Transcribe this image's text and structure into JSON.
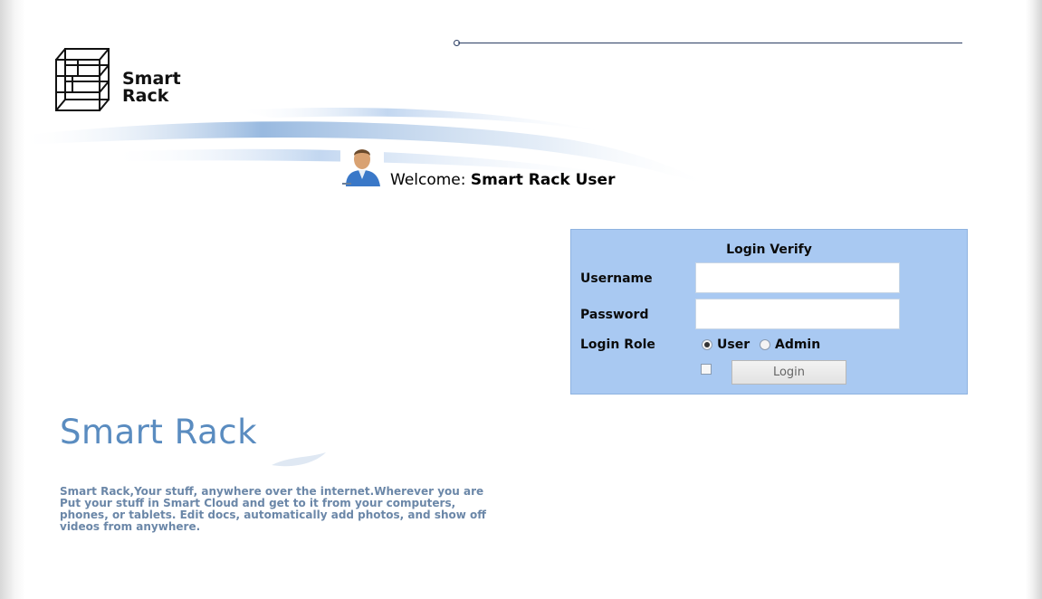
{
  "logo": {
    "line1": "Smart",
    "line2": "Rack",
    "icon": "rack-icon"
  },
  "welcome": {
    "prefix": "Welcome:",
    "user": "Smart Rack User",
    "icon": "user-avatar-icon"
  },
  "login": {
    "title": "Login Verify",
    "username_label": "Username",
    "username_value": "",
    "password_label": "Password",
    "password_value": "",
    "role_label": "Login Role",
    "roles": [
      {
        "label": "User",
        "selected": true
      },
      {
        "label": "Admin",
        "selected": false
      }
    ],
    "remember_checked": false,
    "button_label": "Login"
  },
  "brand": {
    "title": "Smart Rack",
    "description": "Smart Rack,Your stuff, anywhere over the internet.Wherever you are Put your stuff in Smart Cloud and get to it from your computers, phones, or tablets. Edit docs, automatically add photos, and show off videos from anywhere."
  },
  "colors": {
    "login_panel": "#a9c9f2",
    "brand_blue": "#5a8cc0",
    "desc_text": "#6b87a8",
    "top_line": "#2c3e64"
  }
}
